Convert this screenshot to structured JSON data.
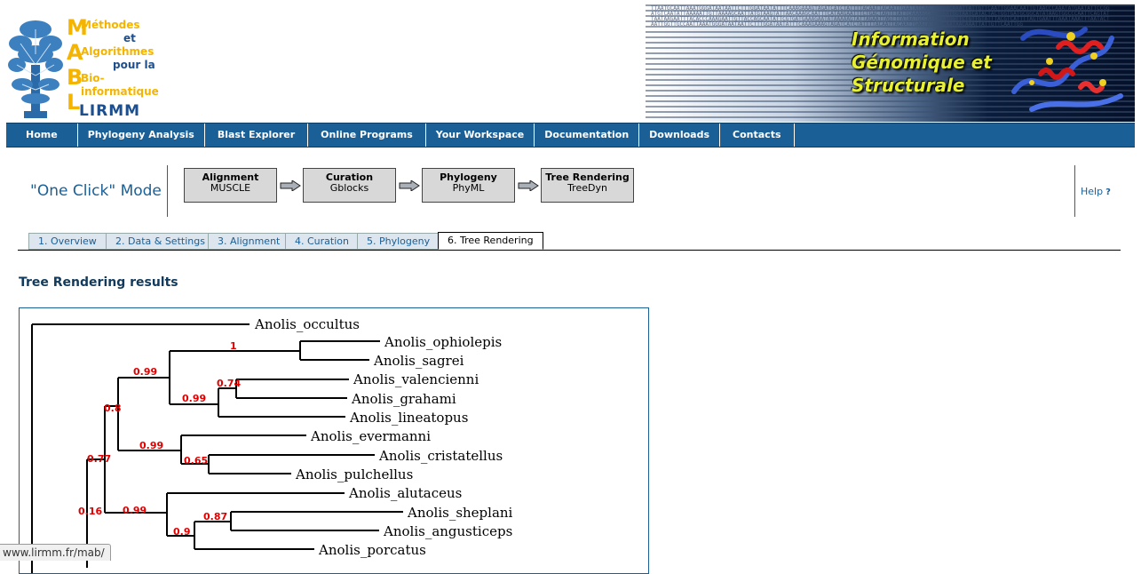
{
  "logo": {
    "letters": [
      "M",
      "A",
      "B",
      "L"
    ],
    "words": [
      "Méthodes",
      "et",
      "Algorithmes",
      "pour la",
      "Bio-informatique"
    ],
    "org": "LIRMM"
  },
  "banner": {
    "title_lines": [
      "Information",
      "Génomique et",
      "Structurale"
    ],
    "dna_text": "TTAATGCAATTAAATGGGATAATAATTCTTTGGATAATATTTCAAAGAAAGTAGATCATCTATTTTACAATTACAATTGAATATCAACAATAACAAATTATTGTTCAATTGGAACAATTGTAACCCAAATATGAATATTCCGGATGTCAATATTAAAAATTGTTAAAAGCAATTATGTAAGTATTAACAAAGCAATTTCATAAGAATTTCTGACTAGTTTATTCAAAAGCAATAAATGGTAATCATACTACTGGTGATGCGGCATATAAGTGGCCCAATTCAGTATTAATAAGAATTTACACCCAAAGAATTGTTACCAGCAATATTCGTGATGAAAGAATATAAAAAGTATTAGAATTAGTTTATAATGCCAATGTATGGTTCTGTTGTATTTACGTCATTTTAGTGAATTTAAATAAATTTAATACTAATTGGTTGCCAATTAAATGGGATAATAATTCTTTGGATAATATTTCAAAGAAAGTAGATCATCTATTTTACAATTACAATTGAATATCAACAATAACAAATTATTGTTCAATTGG"
  },
  "nav": [
    "Home",
    "Phylogeny Analysis",
    "Blast Explorer",
    "Online Programs",
    "Your Workspace",
    "Documentation",
    "Downloads",
    "Contacts"
  ],
  "mode": {
    "title": "\"One Click\" Mode",
    "steps": [
      {
        "title": "Alignment",
        "sub": "MUSCLE"
      },
      {
        "title": "Curation",
        "sub": "Gblocks"
      },
      {
        "title": "Phylogeny",
        "sub": "PhyML"
      },
      {
        "title": "Tree Rendering",
        "sub": "TreeDyn"
      }
    ],
    "help": "Help"
  },
  "tabs": [
    {
      "label": "1. Overview",
      "active": false
    },
    {
      "label": "2. Data & Settings",
      "active": false
    },
    {
      "label": "3. Alignment",
      "active": false
    },
    {
      "label": "4. Curation",
      "active": false
    },
    {
      "label": "5. Phylogeny",
      "active": false
    },
    {
      "label": "6. Tree Rendering",
      "active": true
    }
  ],
  "results_title": "Tree Rendering results",
  "tree": {
    "leaves": [
      "Anolis_occultus",
      "Anolis_ophiolepis",
      "Anolis_sagrei",
      "Anolis_valencienni",
      "Anolis_grahami",
      "Anolis_lineatopus",
      "Anolis_evermanni",
      "Anolis_cristatellus",
      "Anolis_pulchellus",
      "Anolis_alutaceus",
      "Anolis_sheplani",
      "Anolis_angusticeps",
      "Anolis_porcatus"
    ],
    "supports": [
      "1",
      "0.99",
      "0.74",
      "0.99",
      "0.8",
      "0.99",
      "0.65",
      "0.77",
      "0.16",
      "0.99",
      "0.87",
      "0.9"
    ],
    "branch_color": "#000000",
    "support_color": "#e00000"
  },
  "status_url": "www.lirmm.fr/mab/"
}
